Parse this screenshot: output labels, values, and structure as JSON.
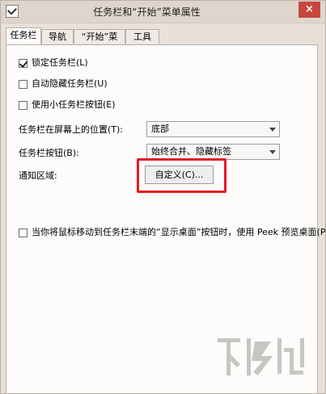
{
  "window": {
    "title": "任务栏和“开始”菜单属性",
    "close_glyph": "×"
  },
  "tabs": [
    {
      "label": "任务栏",
      "active": true
    },
    {
      "label": "导航",
      "active": false
    },
    {
      "label": "“开始”菜单",
      "active": false
    },
    {
      "label": "工具栏",
      "active": false
    }
  ],
  "checkboxes": [
    {
      "label": "锁定任务栏(L)",
      "checked": true
    },
    {
      "label": "自动隐藏任务栏(U)",
      "checked": false
    },
    {
      "label": "使用小任务栏按钮(E)",
      "checked": false
    }
  ],
  "position_row": {
    "label": "任务栏在屏幕上的位置(T):",
    "selected": "底部"
  },
  "buttons_row": {
    "label": "任务栏按钮(B):",
    "selected": "始终合并、隐藏标签"
  },
  "notify_row": {
    "label": "通知区域:",
    "button": "自定义(C)..."
  },
  "peek": {
    "label": "当你将鼠标移动到任务栏末端的“显示桌面”按钮时，使用 Peek 预览桌面(P)",
    "checked": false
  },
  "colors": {
    "highlight": "#e31b23",
    "close": "#c7473e"
  },
  "icons": [
    "taskbar-app-icon",
    "close-icon",
    "dropdown-arrow-icon",
    "checkmark-icon"
  ]
}
